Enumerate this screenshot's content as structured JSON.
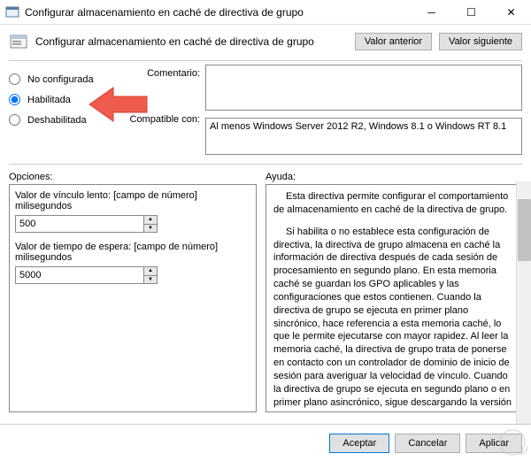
{
  "window": {
    "title": "Configurar almacenamiento en caché de directiva de grupo"
  },
  "header": {
    "title": "Configurar almacenamiento en caché de directiva de grupo",
    "prev": "Valor anterior",
    "next": "Valor siguiente"
  },
  "radios": {
    "not_configured": "No configurada",
    "enabled": "Habilitada",
    "disabled": "Deshabilitada",
    "selected": "enabled"
  },
  "fields": {
    "comment_label": "Comentario:",
    "comment_value": "",
    "compat_label": "Compatible con:",
    "compat_value": "Al menos Windows Server 2012 R2, Windows 8.1 o Windows RT 8.1"
  },
  "sections": {
    "options": "Opciones:",
    "help": "Ayuda:"
  },
  "options": {
    "slow_link_label": "Valor de vínculo lento: [campo de número] milisegundos",
    "slow_link_value": "500",
    "timeout_label": "Valor de tiempo de espera: [campo de número] milisegundos",
    "timeout_value": "5000"
  },
  "help": {
    "p1": "Esta directiva permite configurar el comportamiento de almacenamiento en caché de la directiva de grupo.",
    "p2": "Si habilita o no establece esta configuración de directiva, la directiva de grupo almacena en caché la información de directiva después de cada sesión de procesamiento en segundo plano. En esta memoria caché se guardan los GPO aplicables y las configuraciones que estos contienen. Cuando la directiva de grupo se ejecuta en primer plano sincrónico, hace referencia a esta memoria caché, lo que le permite ejecutarse con mayor rapidez. Al leer la memoria caché, la directiva de grupo trata de ponerse en contacto con un controlador de dominio de inicio de sesión para averiguar la velocidad de vínculo. Cuando la directiva de grupo se ejecuta en segundo plano o en primer plano asincrónico, sigue descargando la versión más reciente de la información de directiva y emplea una estimación de ancho de"
  },
  "footer": {
    "ok": "Aceptar",
    "cancel": "Cancelar",
    "apply": "Aplicar"
  }
}
